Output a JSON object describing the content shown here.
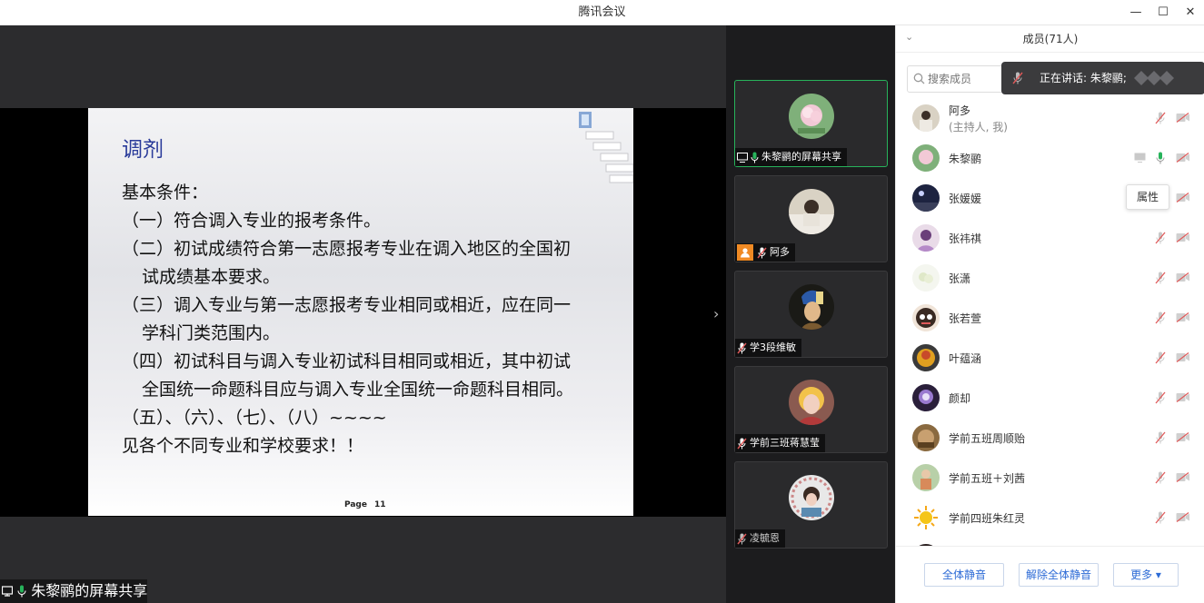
{
  "window": {
    "title": "腾讯会议",
    "minimize": "—",
    "maximize": "☐",
    "close": "✕"
  },
  "slide": {
    "title": "调剂",
    "lines": [
      "基本条件：",
      "（一）符合调入专业的报考条件。",
      "（二）初试成绩符合第一志愿报考专业在调入地区的全国初",
      "试成绩基本要求。",
      "（三）调入专业与第一志愿报考专业相同或相近，应在同一",
      "学科门类范围内。",
      "（四）初试科目与调入专业初试科目相同或相近，其中初试",
      "全国统一命题科目应与调入专业全国统一命题科目相同。",
      "（五）、（六）、（七）、（八）~~~~",
      "见各个不同专业和学校要求！！"
    ],
    "page_label": "Page",
    "page_number": "11"
  },
  "share_label": "朱黎鹂的屏幕共享",
  "video_tiles": [
    {
      "name": "朱黎鹂的屏幕共享",
      "active": true
    },
    {
      "name": "阿多",
      "active": false
    },
    {
      "name": "学3段维敏",
      "active": false
    },
    {
      "name": "学前三班蒋慧莹",
      "active": false
    },
    {
      "name": "凌毓恩",
      "active": false
    }
  ],
  "panel": {
    "title": "成员(71人)",
    "search_placeholder": "搜索成员",
    "speaking_text": "正在讲话: 朱黎鹂;",
    "tooltip": "属性",
    "members": [
      {
        "name": "阿多",
        "sub": "(主持人, 我)",
        "mic": "muted"
      },
      {
        "name": "朱黎鹂",
        "sub": "",
        "mic": "on"
      },
      {
        "name": "张媛媛",
        "sub": "",
        "mic": "muted"
      },
      {
        "name": "张祎祺",
        "sub": "",
        "mic": "muted"
      },
      {
        "name": "张潇",
        "sub": "",
        "mic": "muted"
      },
      {
        "name": "张若萱",
        "sub": "",
        "mic": "muted"
      },
      {
        "name": "叶蕴涵",
        "sub": "",
        "mic": "muted"
      },
      {
        "name": "颜却",
        "sub": "",
        "mic": "muted"
      },
      {
        "name": "学前五班周顺贻",
        "sub": "",
        "mic": "muted"
      },
      {
        "name": "学前五班＋刘茜",
        "sub": "",
        "mic": "muted"
      },
      {
        "name": "学前四班朱红灵",
        "sub": "",
        "mic": "muted"
      }
    ],
    "buttons": {
      "mute_all": "全体静音",
      "unmute_all": "解除全体静音",
      "more": "更多 ▾"
    }
  },
  "colors": {
    "accent_green": "#27b35b",
    "mute_red": "#e05a5a",
    "link_blue": "#2d6bd6",
    "slide_title": "#2a3b9a"
  }
}
